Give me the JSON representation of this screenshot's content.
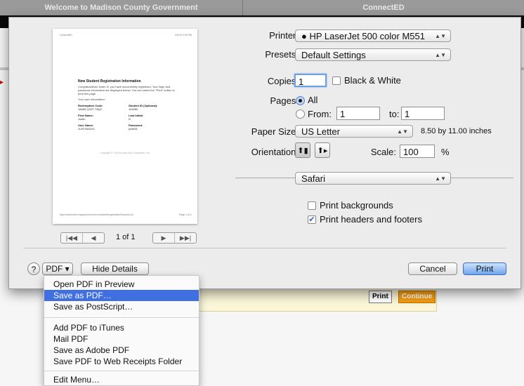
{
  "browser": {
    "tabs": [
      "Welcome to Madison County Government",
      "ConnectED"
    ],
    "bg_buttons": {
      "print": "Print",
      "continue": "Continue"
    }
  },
  "preview": {
    "header_left": "ConnectED",
    "header_right": "9/4/13 2:39 PM",
    "title": "New Student Registration Information",
    "paragraph": "Congratulations Justin N. you have successfully registered. Your login and password information are displayed below. You can select the \"Print\" button to print this page.",
    "subheading": "Your user information:",
    "fields": [
      {
        "label": "Redemption Code:",
        "value": "18689-QX9T-T8Q2"
      },
      {
        "label": "Student ID (Optional):",
        "value": "163080"
      },
      {
        "label": "First Name:",
        "value": "Justin"
      },
      {
        "label": "Last Initial:",
        "value": "N"
      },
      {
        "label": "User Name:",
        "value": "JUSTINN243"
      },
      {
        "label": "Password:",
        "value": "just651"
      }
    ],
    "center_text": "Copyright © The McGraw-Hill Companies, Inc.",
    "footer_left": "http://connected.mcgraw-hill.com/connected/registrationSuccess.do",
    "footer_right": "Page 1 of 1",
    "page_count": "1 of 1",
    "nav_first": "|◀◀",
    "nav_prev": "◀",
    "nav_next": "▶",
    "nav_last": "▶▶|"
  },
  "form": {
    "printer_label": "Printer:",
    "printer_value": "HP LaserJet 500 color M551",
    "presets_label": "Presets:",
    "presets_value": "Default Settings",
    "copies_label": "Copies:",
    "copies_value": "1",
    "bw_label": "Black & White",
    "pages_label": "Pages:",
    "pages_all": "All",
    "pages_from": "From:",
    "from_value": "1",
    "pages_to": "to:",
    "to_value": "1",
    "paper_label": "Paper Size:",
    "paper_value": "US Letter",
    "paper_dims": "8.50 by 11.00 inches",
    "orientation_label": "Orientation:",
    "scale_label": "Scale:",
    "scale_value": "100",
    "scale_unit": "%",
    "section_value": "Safari",
    "print_backgrounds": "Print backgrounds",
    "print_backgrounds_checked": false,
    "print_headers": "Print headers and footers",
    "print_headers_checked": true
  },
  "bottom": {
    "help": "?",
    "pdf_label": "PDF ▾",
    "hide_details": "Hide Details",
    "cancel": "Cancel",
    "print": "Print"
  },
  "pdf_menu": {
    "group1": [
      "Open PDF in Preview",
      "Save as PDF…",
      "Save as PostScript…"
    ],
    "selected": "Save as PDF…",
    "group2": [
      "Add PDF to iTunes",
      "Mail PDF",
      "Save as Adobe PDF",
      "Save PDF to Web Receipts Folder"
    ],
    "group3": [
      "Edit Menu…"
    ]
  }
}
